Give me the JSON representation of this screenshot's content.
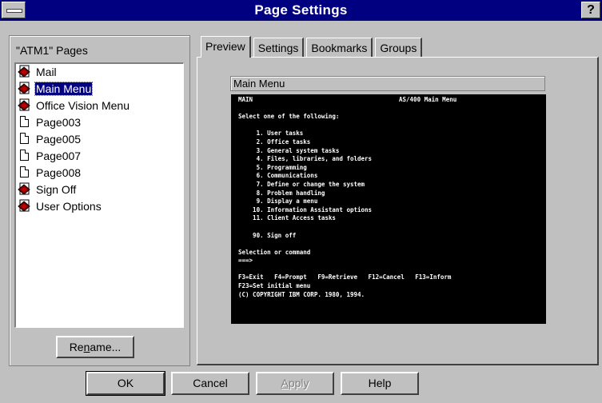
{
  "window": {
    "title": "Page Settings",
    "help_glyph": "?"
  },
  "pages": {
    "title": "\"ATM1\" Pages",
    "items": [
      {
        "label": "Mail",
        "icon": "diamond-page-icon"
      },
      {
        "label": "Main Menu",
        "icon": "diamond-page-icon",
        "selected": true
      },
      {
        "label": "Office Vision Menu",
        "icon": "diamond-page-icon"
      },
      {
        "label": "Page003",
        "icon": "document-icon"
      },
      {
        "label": "Page005",
        "icon": "document-icon"
      },
      {
        "label": "Page007",
        "icon": "document-icon"
      },
      {
        "label": "Page008",
        "icon": "document-icon"
      },
      {
        "label": "Sign Off",
        "icon": "diamond-page-icon"
      },
      {
        "label": "User Options",
        "icon": "diamond-page-icon"
      }
    ],
    "rename_prefix": "Re",
    "rename_mnemonic": "n",
    "rename_suffix": "ame..."
  },
  "tabs": [
    "Preview",
    "Settings",
    "Bookmarks",
    "Groups"
  ],
  "preview": {
    "page_name": "Main Menu",
    "screen_left": "MAIN",
    "screen_right": "AS/400 Main Menu",
    "screen_lines": [
      "",
      "Select one of the following:",
      "",
      "     1. User tasks",
      "     2. Office tasks",
      "     3. General system tasks",
      "     4. Files, libraries, and folders",
      "     5. Programming",
      "     6. Communications",
      "     7. Define or change the system",
      "     8. Problem handling",
      "     9. Display a menu",
      "    10. Information Assistant options",
      "    11. Client Access tasks",
      "",
      "    90. Sign off",
      "",
      "Selection or command",
      "===>",
      "",
      "F3=Exit   F4=Prompt   F9=Retrieve   F12=Cancel   F13=Inform",
      "F23=Set initial menu",
      "(C) COPYRIGHT IBM CORP. 1980, 1994."
    ]
  },
  "buttons": {
    "ok": "OK",
    "cancel": "Cancel",
    "apply_mnemonic": "A",
    "apply_rest": "pply",
    "help": "Help"
  }
}
